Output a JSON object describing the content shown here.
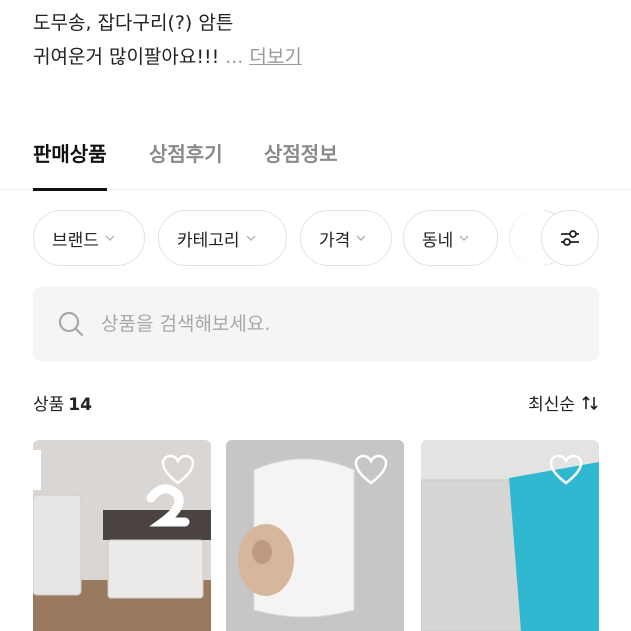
{
  "description": {
    "line1": "도무송, 잡다구리(?) 암튼",
    "line2": "귀여운거 많이팔아요!!!",
    "ellipsis": "...",
    "more_label": "더보기"
  },
  "tabs": [
    {
      "label": "판매상품",
      "active": true
    },
    {
      "label": "상점후기",
      "active": false
    },
    {
      "label": "상점정보",
      "active": false
    }
  ],
  "filters": [
    {
      "label": "브랜드"
    },
    {
      "label": "카테고리"
    },
    {
      "label": "가격"
    },
    {
      "label": "동네"
    }
  ],
  "search": {
    "placeholder": "상품을 검색해보세요.",
    "value": ""
  },
  "list": {
    "count_label": "상품",
    "count": "14",
    "sort_label": "최신순"
  },
  "icons": {
    "search": "search-icon",
    "chevron": "chevron-down-icon",
    "settings": "filter-sliders-icon",
    "sort": "sort-arrows-icon",
    "heart": "heart-outline-icon"
  },
  "colors": {
    "accent_text": "#111111",
    "muted_text": "#8a8a8a",
    "chip_border": "#e3e3e3",
    "search_bg": "#f5f5f5"
  }
}
